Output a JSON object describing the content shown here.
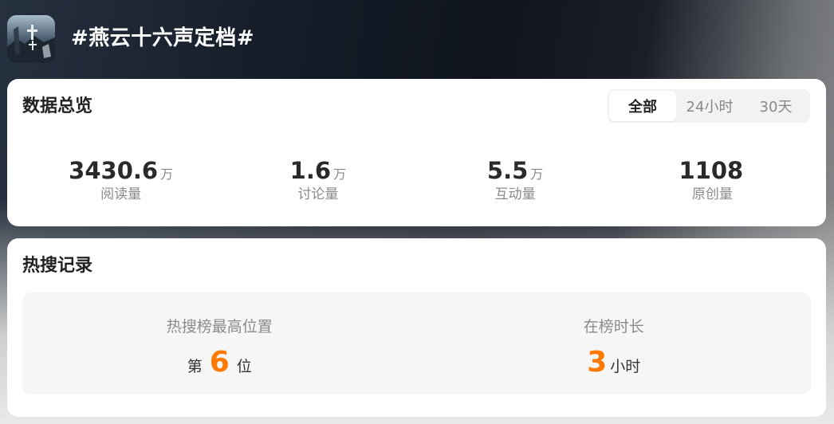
{
  "topic": {
    "title": "#燕云十六声定档#",
    "avatar_icon": "game-cover-image"
  },
  "overview": {
    "title": "数据总览",
    "tabs": [
      {
        "label": "全部",
        "active": true
      },
      {
        "label": "24小时",
        "active": false
      },
      {
        "label": "30天",
        "active": false
      }
    ],
    "stats": [
      {
        "value": "3430.6",
        "unit": "万",
        "label": "阅读量"
      },
      {
        "value": "1.6",
        "unit": "万",
        "label": "讨论量"
      },
      {
        "value": "5.5",
        "unit": "万",
        "label": "互动量"
      },
      {
        "value": "1108",
        "unit": "",
        "label": "原创量"
      }
    ]
  },
  "hot_search": {
    "title": "热搜记录",
    "best_position": {
      "label": "热搜榜最高位置",
      "prefix": "第",
      "value": "6",
      "suffix": "位"
    },
    "duration": {
      "label": "在榜时长",
      "value": "3",
      "suffix": "小时"
    },
    "accent_color": "#ff7a00"
  }
}
